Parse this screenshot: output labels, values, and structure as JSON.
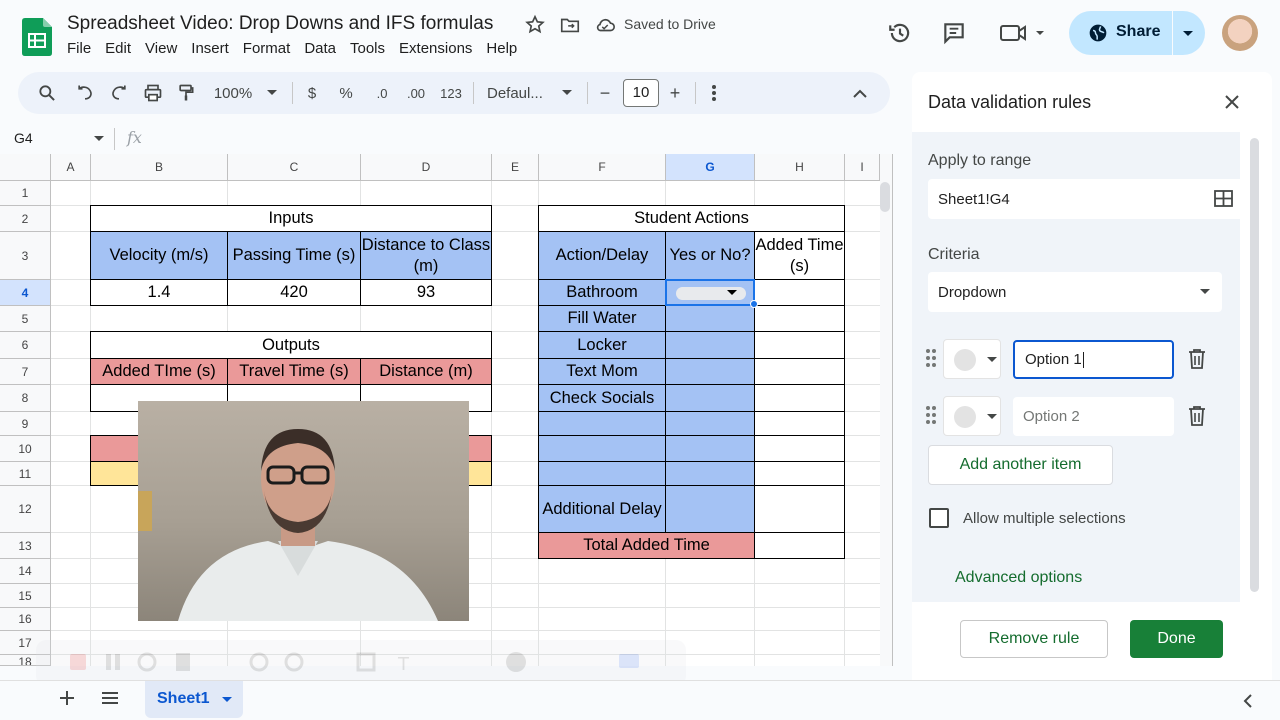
{
  "app": {
    "title": "Spreadsheet Video: Drop Downs and IFS formulas",
    "saved_status": "Saved to Drive",
    "menu": [
      "File",
      "Edit",
      "View",
      "Insert",
      "Format",
      "Data",
      "Tools",
      "Extensions",
      "Help"
    ],
    "share_label": "Share"
  },
  "toolbar": {
    "zoom": "100%",
    "currency": "$",
    "percent": "%",
    "dec_decrease": ".0",
    "dec_increase": ".00",
    "number_format": "123",
    "font": "Defaul...",
    "font_size": "10",
    "minus": "−",
    "plus": "+"
  },
  "formula_bar": {
    "cell_ref": "G4",
    "fx": "fx"
  },
  "grid": {
    "columns": [
      "A",
      "B",
      "C",
      "D",
      "E",
      "F",
      "G",
      "H",
      "I"
    ],
    "rows": [
      "1",
      "2",
      "3",
      "4",
      "5",
      "6",
      "7",
      "8",
      "9",
      "10",
      "11",
      "12",
      "13",
      "14",
      "15",
      "16",
      "17",
      "18"
    ],
    "selected_column": "G",
    "selected_row": "4"
  },
  "cells": {
    "inputs_title": "Inputs",
    "velocity": "Velocity (m/s)",
    "passing_time": "Passing Time (s)",
    "distance_to_class": "Distance to Class (m)",
    "velocity_val": "1.4",
    "passing_val": "420",
    "distance_val": "93",
    "outputs_title": "Outputs",
    "added_time_out": "Added TIme (s)",
    "travel_time": "Travel Time (s)",
    "distance_out": "Distance (m)",
    "student_actions": "Student Actions",
    "action_delay": "Action/Delay",
    "yes_or_no": "Yes or No?",
    "added_time_hdr": "Added Time (s)",
    "actions": [
      "Bathroom",
      "Fill Water",
      "Locker",
      "Text Mom",
      "Check Socials"
    ],
    "additional_delay": "Additional Delay",
    "total_added_time": "Total Added Time"
  },
  "sheet_tab": "Sheet1",
  "panel": {
    "title": "Data validation rules",
    "apply_label": "Apply to range",
    "range": "Sheet1!G4",
    "criteria_label": "Criteria",
    "criteria_value": "Dropdown",
    "option1": "Option 1",
    "option2_placeholder": "Option 2",
    "add_item": "Add another item",
    "allow_multiple": "Allow multiple selections",
    "advanced": "Advanced options",
    "remove_rule": "Remove rule",
    "done": "Done"
  },
  "colors": {
    "blue_fill": "#a4c2f4",
    "red_fill": "#ea9999",
    "yellow_fill": "#ffe599",
    "share_bg": "#c2e7ff",
    "done_bg": "#188038",
    "accent_green": "#146c2e",
    "selection_blue": "#1a73e8"
  }
}
